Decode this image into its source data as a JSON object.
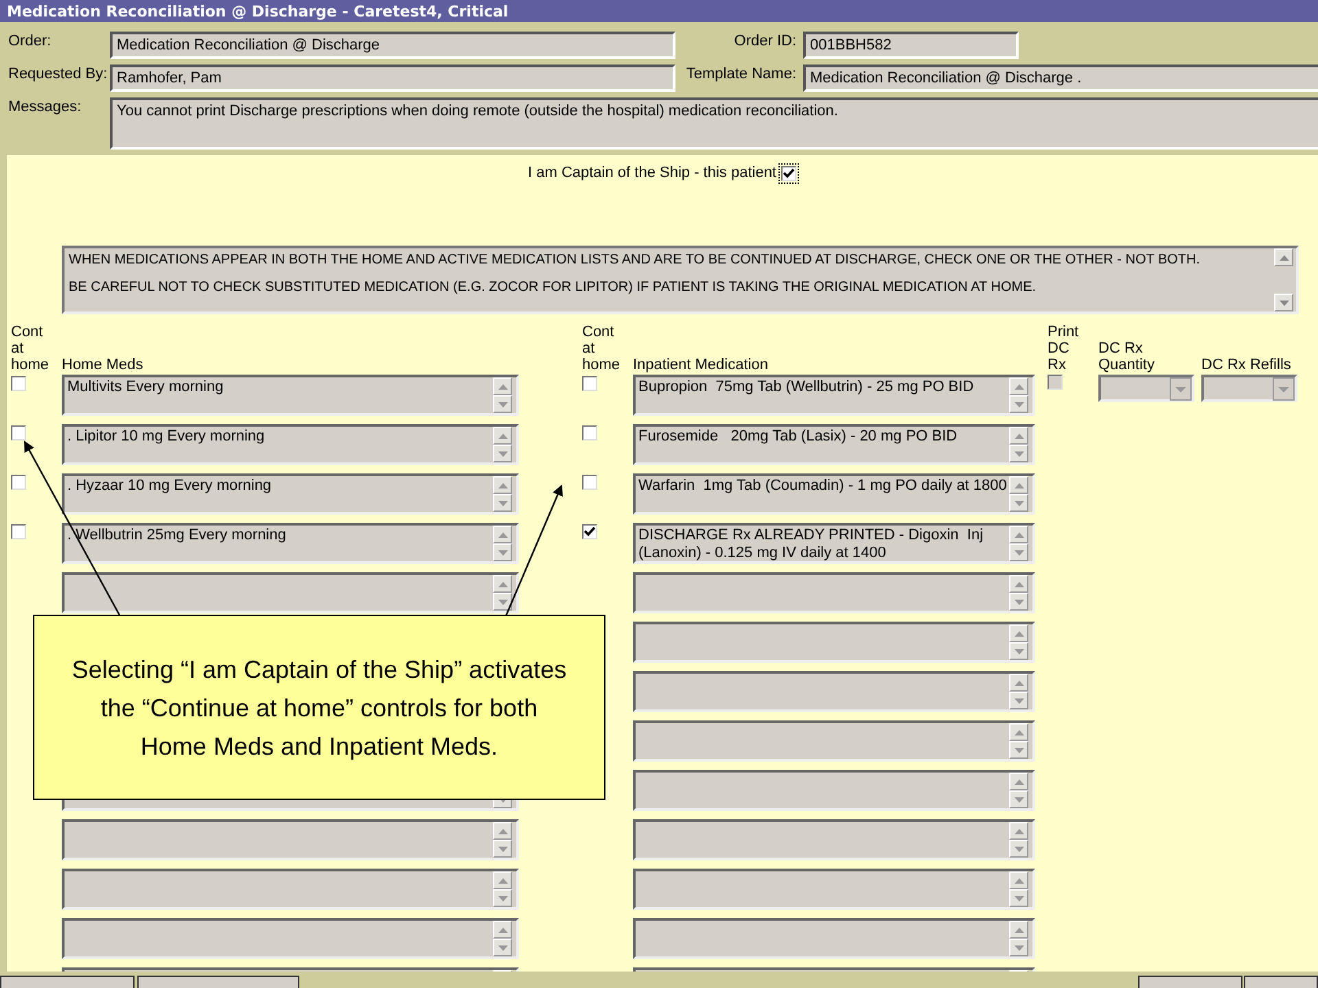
{
  "window": {
    "title": "Medication Reconciliation @ Discharge - Caretest4, Critical"
  },
  "header": {
    "order": {
      "label": "Order:",
      "value": "Medication Reconciliation @ Discharge"
    },
    "order_id": {
      "label": "Order ID:",
      "value": "001BBH582"
    },
    "requested_by": {
      "label": "Requested By:",
      "value": "Ramhofer, Pam"
    },
    "template_name": {
      "label": "Template Name:",
      "value": "Medication Reconciliation @ Discharge ."
    },
    "messages": {
      "label": "Messages:",
      "value": "You cannot print Discharge prescriptions when doing remote (outside the hospital) medication reconciliation."
    }
  },
  "captain": {
    "label": "I am Captain of the Ship - this patient",
    "checked": true
  },
  "notes": [
    "WHEN MEDICATIONS APPEAR IN BOTH THE HOME AND ACTIVE MEDICATION LISTS AND ARE TO BE CONTINUED AT DISCHARGE, CHECK ONE OR THE OTHER - NOT BOTH.",
    "BE CAREFUL NOT TO CHECK SUBSTITUTED MEDICATION (E.G. ZOCOR FOR LIPITOR) IF PATIENT IS TAKING THE ORIGINAL MEDICATION AT HOME."
  ],
  "columns": {
    "cont_home": "Cont at home",
    "home_meds": "Home Meds",
    "cont_inpatient": "Cont at home",
    "inpatient": "Inpatient Medication",
    "print_dc_rx": "Print DC Rx",
    "dc_rx_quantity": "DC Rx Quantity",
    "dc_rx_refills": "DC Rx Refills"
  },
  "rows": [
    {
      "kind": "medication",
      "home_med": "Multivits Every morning",
      "home_checked": false,
      "inpatient_med": "Bupropion  75mg Tab (Wellbutrin) - 25 mg PO BID",
      "inpatient_checked": false,
      "print_rx": {
        "checked": false,
        "disabled": true
      },
      "quantity": {
        "disabled": true
      },
      "refills": {
        "disabled": true
      }
    },
    {
      "kind": "medication",
      "home_med": ". Lipitor 10 mg Every morning",
      "home_checked": false,
      "inpatient_med": "Furosemide   20mg Tab (Lasix) - 20 mg PO BID",
      "inpatient_checked": false
    },
    {
      "kind": "medication",
      "home_med": ". Hyzaar 10 mg Every morning",
      "home_checked": false,
      "inpatient_med": "Warfarin  1mg Tab (Coumadin) - 1 mg PO daily at 1800",
      "inpatient_checked": false
    },
    {
      "kind": "medication",
      "home_med": ". Wellbutrin 25mg Every morning",
      "home_checked": false,
      "inpatient_med": "DISCHARGE Rx ALREADY PRINTED - Digoxin  Inj (Lanoxin) - 0.125 mg IV daily at 1400",
      "inpatient_checked": true
    },
    {
      "kind": "empty"
    },
    {
      "kind": "covered"
    },
    {
      "kind": "covered"
    },
    {
      "kind": "covered"
    },
    {
      "kind": "partly_covered"
    },
    {
      "kind": "empty"
    },
    {
      "kind": "empty"
    },
    {
      "kind": "empty"
    },
    {
      "kind": "cut"
    }
  ],
  "callout": {
    "text": "Selecting “I am Captain of the Ship” activates the “Continue at home” controls for both Home Meds and Inpatient Meds."
  }
}
